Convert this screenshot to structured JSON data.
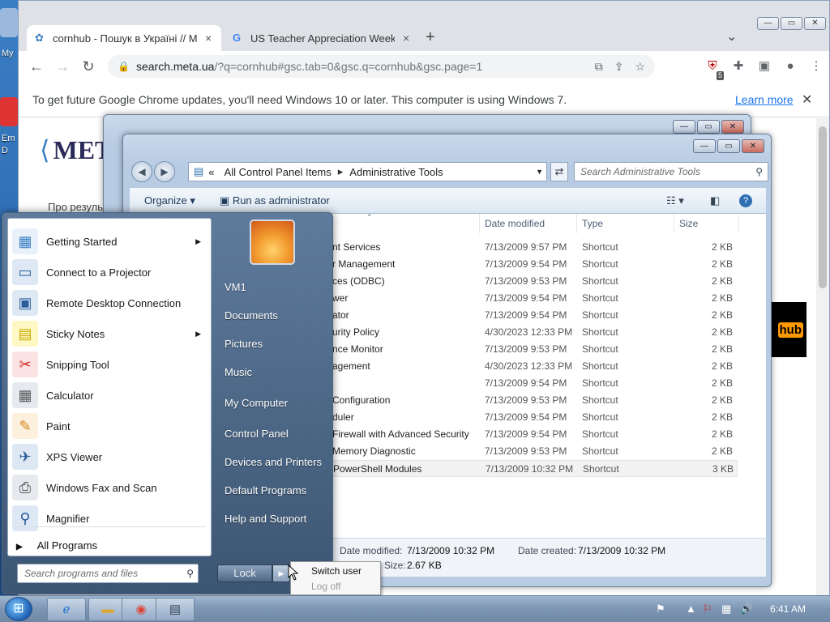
{
  "chrome": {
    "tabs": [
      {
        "title": "cornhub - Пошук в Україні // Ме",
        "close": "×"
      },
      {
        "title": "US Teacher Appreciation Week -",
        "close": "×"
      }
    ],
    "new_tab": "+",
    "tab_list": "⌄",
    "url_host": "search.meta.ua",
    "url_path": "/?q=cornhub#gsc.tab=0&gsc.q=cornhub&gsc.page=1",
    "extension_badge": "5",
    "infobar_text": "To get future Google Chrome updates, you'll need Windows 10 or later. This computer is using Windows 7.",
    "infobar_link": "Learn more",
    "page": {
      "logo": "МЕТ",
      "results_prefix": "Про резуль",
      "partial_logo": "hub"
    }
  },
  "explorer": {
    "breadcrumb": [
      "All Control Panel Items",
      "Administrative Tools"
    ],
    "search_placeholder": "Search Administrative Tools",
    "toolbar": {
      "organize": "Organize",
      "run_as": "Run as administrator"
    },
    "columns": {
      "date": "Date modified",
      "type": "Type",
      "size": "Size"
    },
    "rows": [
      {
        "name": "nt Services",
        "date": "7/13/2009 9:57 PM",
        "type": "Shortcut",
        "size": "2 KB"
      },
      {
        "name": "r Management",
        "date": "7/13/2009 9:54 PM",
        "type": "Shortcut",
        "size": "2 KB"
      },
      {
        "name": "ces (ODBC)",
        "date": "7/13/2009 9:53 PM",
        "type": "Shortcut",
        "size": "2 KB"
      },
      {
        "name": "wer",
        "date": "7/13/2009 9:54 PM",
        "type": "Shortcut",
        "size": "2 KB"
      },
      {
        "name": "ator",
        "date": "7/13/2009 9:54 PM",
        "type": "Shortcut",
        "size": "2 KB"
      },
      {
        "name": "urity Policy",
        "date": "4/30/2023 12:33 PM",
        "type": "Shortcut",
        "size": "2 KB"
      },
      {
        "name": "nce Monitor",
        "date": "7/13/2009 9:53 PM",
        "type": "Shortcut",
        "size": "2 KB"
      },
      {
        "name": "agement",
        "date": "4/30/2023 12:33 PM",
        "type": "Shortcut",
        "size": "2 KB"
      },
      {
        "name": "",
        "date": "7/13/2009 9:54 PM",
        "type": "Shortcut",
        "size": "2 KB"
      },
      {
        "name": "Configuration",
        "date": "7/13/2009 9:53 PM",
        "type": "Shortcut",
        "size": "2 KB"
      },
      {
        "name": "duler",
        "date": "7/13/2009 9:54 PM",
        "type": "Shortcut",
        "size": "2 KB"
      },
      {
        "name": "Firewall with Advanced Security",
        "date": "7/13/2009 9:54 PM",
        "type": "Shortcut",
        "size": "2 KB"
      },
      {
        "name": "Memory Diagnostic",
        "date": "7/13/2009 9:53 PM",
        "type": "Shortcut",
        "size": "2 KB"
      },
      {
        "name": "PowerShell Modules",
        "date": "7/13/2009 10:32 PM",
        "type": "Shortcut",
        "size": "3 KB"
      }
    ],
    "details": {
      "modified_label": "Date modified:",
      "modified_value": "7/13/2009 10:32 PM",
      "created_label": "Date created:",
      "created_value": "7/13/2009 10:32 PM",
      "size_label": "Size:",
      "size_value": "2.67 KB"
    }
  },
  "start_menu": {
    "programs": [
      {
        "label": "Getting Started",
        "arrow": "▶"
      },
      {
        "label": "Connect to a Projector",
        "arrow": ""
      },
      {
        "label": "Remote Desktop Connection",
        "arrow": ""
      },
      {
        "label": "Sticky Notes",
        "arrow": "▶"
      },
      {
        "label": "Snipping Tool",
        "arrow": ""
      },
      {
        "label": "Calculator",
        "arrow": ""
      },
      {
        "label": "Paint",
        "arrow": ""
      },
      {
        "label": "XPS Viewer",
        "arrow": ""
      },
      {
        "label": "Windows Fax and Scan",
        "arrow": ""
      },
      {
        "label": "Magnifier",
        "arrow": ""
      }
    ],
    "all_programs": "All Programs",
    "search_placeholder": "Search programs and files",
    "right_links": [
      "VM1",
      "Documents",
      "Pictures",
      "Music",
      "My Computer",
      "Control Panel",
      "Devices and Printers",
      "Default Programs",
      "Help and Support"
    ],
    "lock": "Lock",
    "popup": {
      "switch_user": "Switch user",
      "log_off": "Log off"
    }
  },
  "desktop": {
    "labels": [
      "My",
      "Em",
      "D"
    ]
  },
  "taskbar": {
    "time": "6:41 AM"
  }
}
